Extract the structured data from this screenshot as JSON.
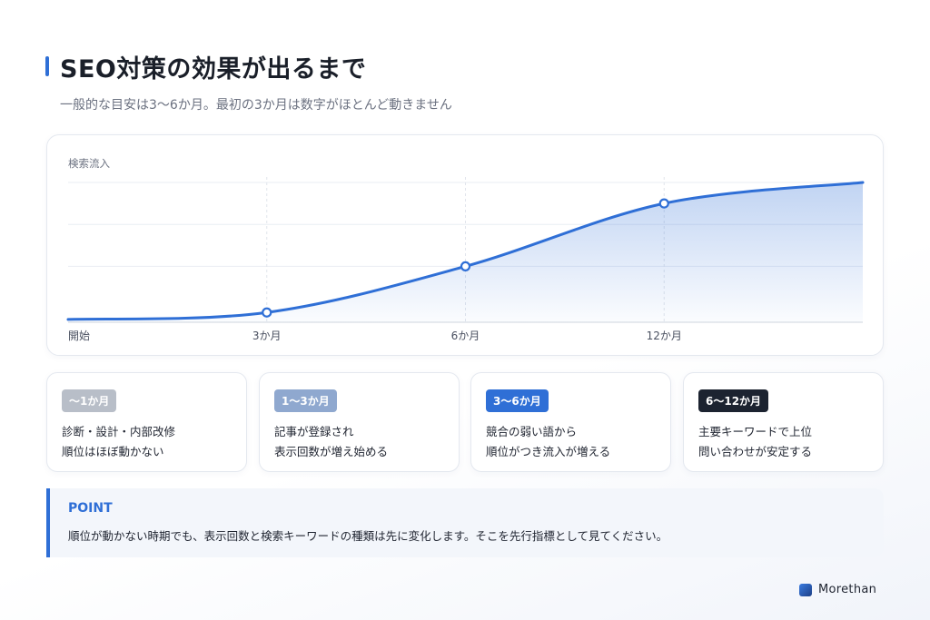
{
  "header": {
    "title": "SEO対策の効果が出るまで",
    "subtitle": "一般的な目安は3〜6か月。最初の3か月は数字がほとんど動きません"
  },
  "chart_data": {
    "type": "area",
    "ylabel": "検索流入",
    "x_ticks": [
      "開始",
      "3か月",
      "6か月",
      "12か月"
    ],
    "x": [
      0,
      3,
      6,
      9,
      12
    ],
    "y": [
      2,
      7,
      40,
      85,
      100
    ],
    "markers": [
      {
        "x": 3,
        "y": 7
      },
      {
        "x": 6,
        "y": 40
      },
      {
        "x": 9,
        "y": 85
      }
    ],
    "ylim": [
      0,
      100
    ],
    "grid": true,
    "line_color": "#2f6fd6",
    "fill_color": "#2f6fd6"
  },
  "steps": [
    {
      "badge": "〜1か月",
      "color": "#b8bec8",
      "line1": "診断・設計・内部改修",
      "line2": "順位はほぼ動かない"
    },
    {
      "badge": "1〜3か月",
      "color": "#8fa8cf",
      "line1": "記事が登録され",
      "line2": "表示回数が増え始める"
    },
    {
      "badge": "3〜6か月",
      "color": "#2f6fd6",
      "line1": "競合の弱い語から",
      "line2": "順位がつき流入が増える"
    },
    {
      "badge": "6〜12か月",
      "color": "#1c2330",
      "line1": "主要キーワードで上位",
      "line2": "問い合わせが安定する"
    }
  ],
  "point": {
    "label": "POINT",
    "text": "順位が動かない時期でも、表示回数と検索キーワードの種類は先に変化します。そこを先行指標として見てください。"
  },
  "brand": {
    "name": "Morethan"
  }
}
